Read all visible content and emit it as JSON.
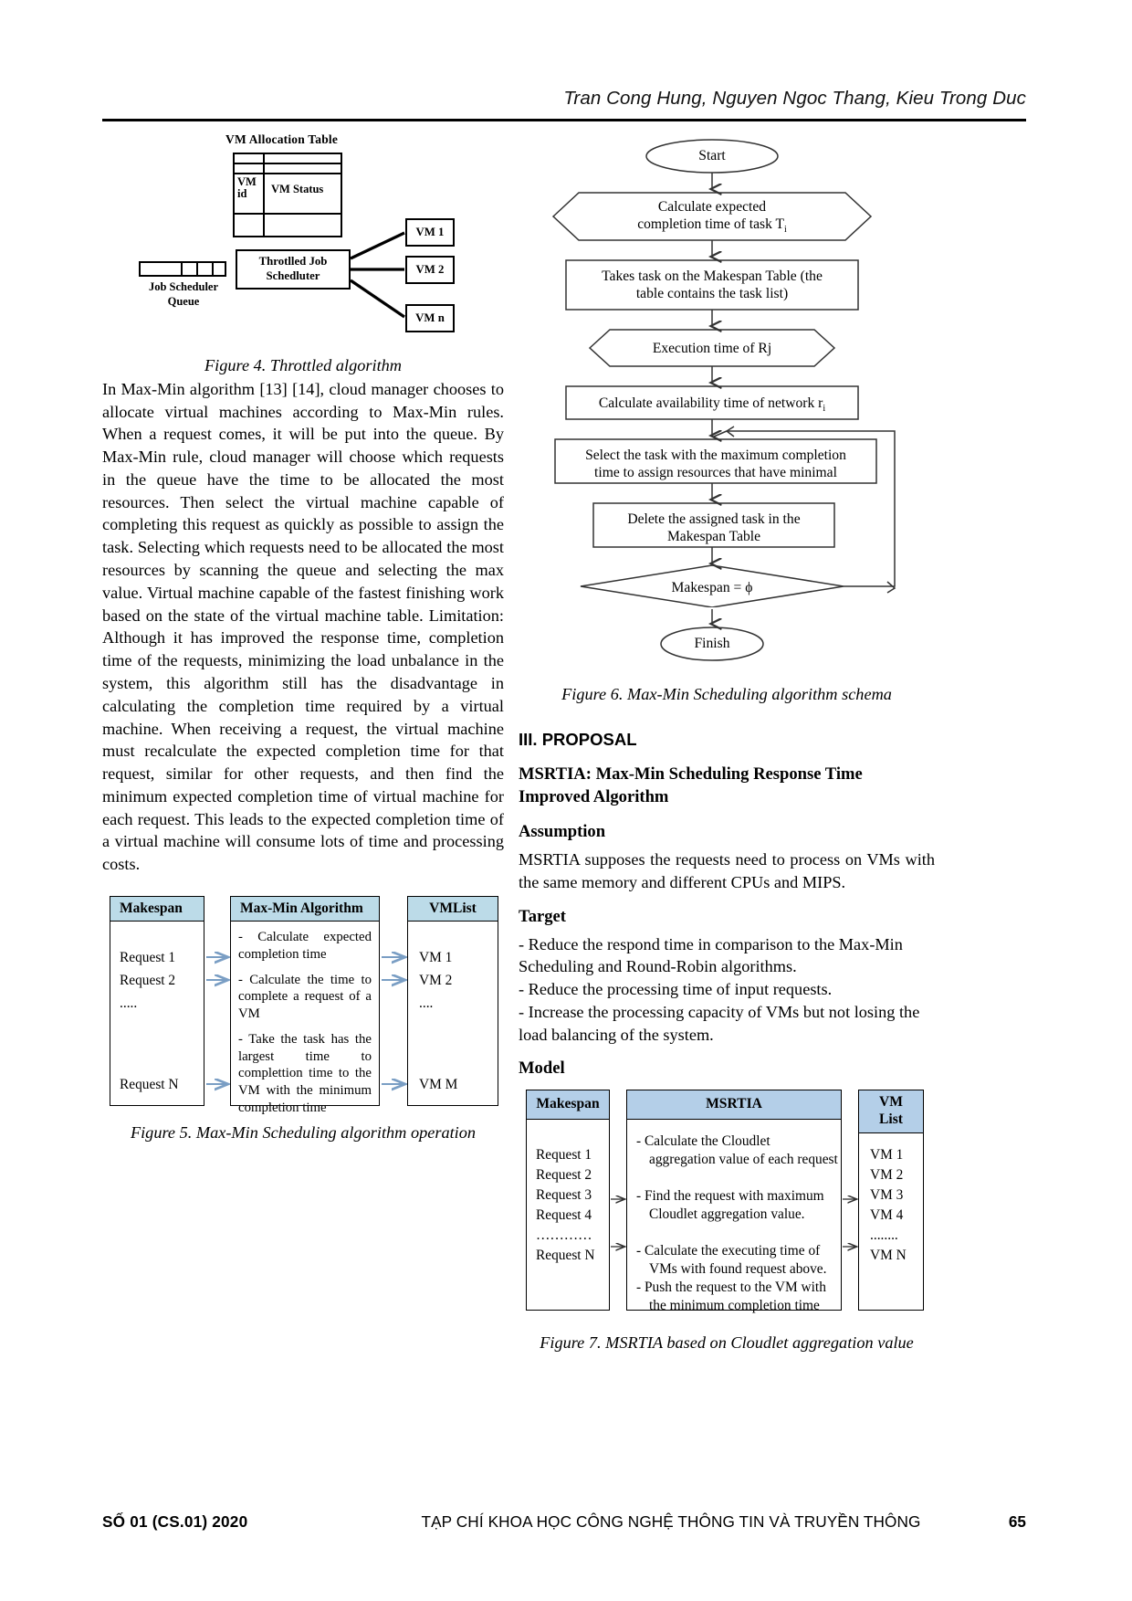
{
  "header": {
    "authors": "Tran Cong Hung, Nguyen Ngoc Thang, Kieu Trong Duc"
  },
  "figure4": {
    "table_title": "VM Allocation Table",
    "col_vm_id": "VM\nid",
    "col_vm_id_line1": "VM",
    "col_vm_id_line2": "id",
    "col_vm_status": "VM Status",
    "queue_label_line1": "Job Scheduler",
    "queue_label_line2": "Queue",
    "scheduler_line1": "Throtlled Job",
    "scheduler_line2": "Schedluter",
    "vm1": "VM 1",
    "vm2": "VM 2",
    "vmn": "VM n",
    "caption": "Figure 4. Throttled algorithm"
  },
  "paragraph1": "In Max-Min algorithm [13] [14], cloud manager chooses to allocate virtual machines according to Max-Min rules. When a request comes, it will be put into the queue. By Max-Min rule, cloud manager will choose which requests in the queue have the time to be allocated the most resources. Then select the virtual machine capable of completing this request as quickly as possible to assign the task. Selecting which requests need to be allocated the most resources by scanning the queue and selecting the max value. Virtual machine capable of the fastest finishing work based on the state of the virtual machine table. Limitation: Although it has improved the response time, completion time of the requests, minimizing the load unbalance in the system, this algorithm still has the disadvantage in calculating the completion time required by a virtual machine. When receiving a request, the virtual machine must recalculate the expected completion time for that request, similar for other requests, and then find the minimum expected completion time of virtual machine for each request. This leads to the expected completion time of a virtual machine will consume lots of time and processing costs.",
  "figure5": {
    "headers": [
      "Makespan",
      "Max-Min Algorithm",
      "VMList"
    ],
    "requests": [
      "Request 1",
      "Request 2",
      ".....",
      "Request N"
    ],
    "algorithm_steps": [
      "- Calculate expected completion time",
      "- Calculate the time to complete a request of a VM",
      "- Take the task has the largest time to complettion time to the VM with the minimum completion time"
    ],
    "vms": [
      "VM 1",
      "VM 2",
      "....",
      "VM M"
    ],
    "caption": "Figure 5. Max-Min Scheduling algorithm operation"
  },
  "figure6": {
    "nodes": {
      "start": "Start",
      "calc_expected_l1": "Calculate expected",
      "calc_expected_l2": "completion time  of task T",
      "calc_expected_sub": "i",
      "takes_task_l1": "Takes task on the Makespan Table (the",
      "takes_task_l2": "table contains the task list)",
      "exec_time": "Execution time of Rj",
      "calc_avail": "Calculate availability time of network r",
      "calc_avail_sub": "i",
      "select_task_l1": "Select the task with the maximum completion",
      "select_task_l2": "time to assign resources that have minimal",
      "delete_task_l1": "Delete the assigned task in the",
      "delete_task_l2": "Makespan Table",
      "makespan_cond": "Makespan = ϕ",
      "finish": "Finish"
    },
    "caption": "Figure 6. Max-Min Scheduling algorithm schema"
  },
  "section": {
    "number_title": "III. PROPOSAL",
    "msrtia_title_l1": "MSRTIA:    Max-Min    Scheduling    Response    Time",
    "msrtia_title_l2": "Improved Algorithm",
    "assumption_head": "Assumption",
    "assumption_text": "MSRTIA supposes the requests need to process on VMs with the same memory and different CPUs and MIPS.",
    "target_head": "Target",
    "target_items": [
      "- Reduce the respond time in comparison to the Max-Min Scheduling and Round-Robin algorithms.",
      "- Reduce the processing time of input requests.",
      "- Increase the processing capacity of VMs but not losing the load balancing of the system."
    ],
    "model_head": "Model"
  },
  "figure7": {
    "headers": [
      "Makespan",
      "MSRTIA",
      "VM List"
    ],
    "header_vmlist_l1": "VM",
    "header_vmlist_l2": "List",
    "requests": [
      "Request 1",
      "Request 2",
      "Request 3",
      "Request 4",
      "…………",
      "Request N"
    ],
    "steps": [
      "-  Calculate the Cloudlet aggregation value of each request",
      "-  Find the request with maximum Cloudlet aggregation value.",
      "-  Calculate the executing time of VMs with found request above.",
      "-  Push the request to the VM with the minimum completion time"
    ],
    "vms": [
      "VM 1",
      "VM 2",
      "VM 3",
      "VM 4",
      "........",
      "VM N"
    ],
    "caption": "Figure 7. MSRTIA based on Cloudlet aggregation value"
  },
  "footer": {
    "left": "SỐ 01 (CS.01) 2020",
    "middle": "TẠP CHÍ KHOA HỌC CÔNG NGHỆ THÔNG TIN VÀ TRUYỀN THÔNG",
    "page": "65"
  },
  "colors": {
    "table_header_blue_fig5": "#bcdbe8",
    "table_header_blue_fig7": "#b4cfe8",
    "arrow_blue": "#7a9ec4",
    "rule_black": "#000000"
  }
}
